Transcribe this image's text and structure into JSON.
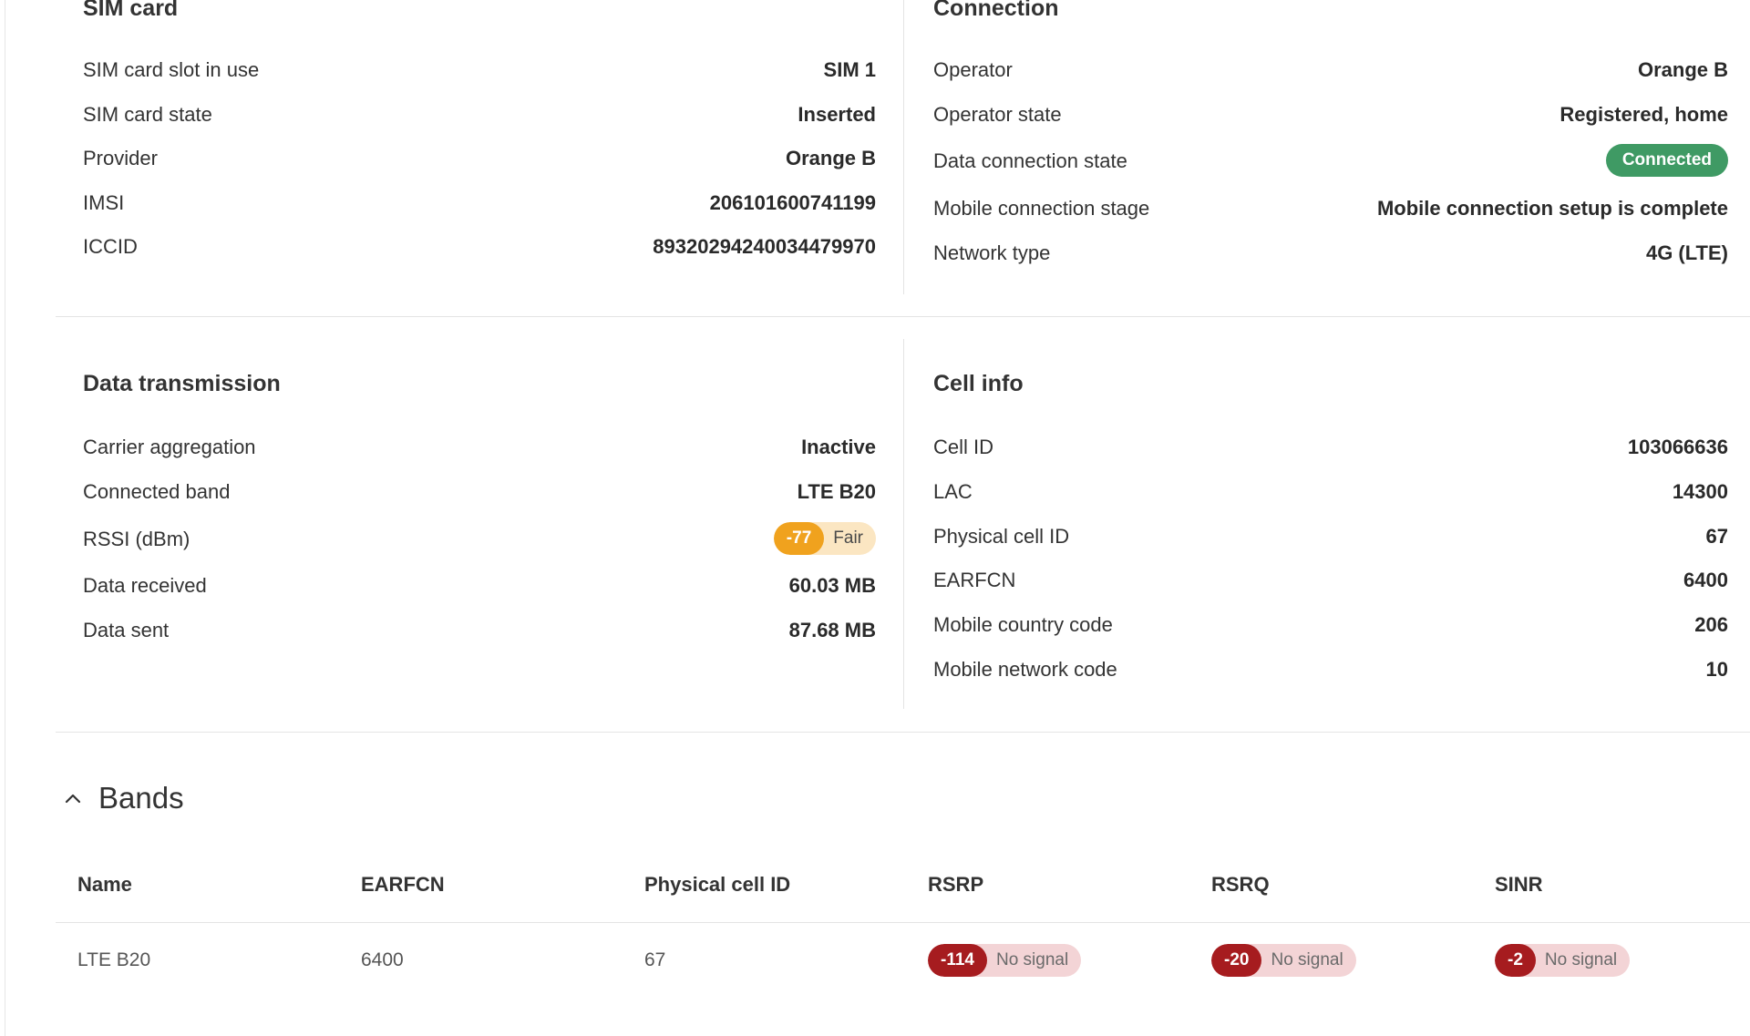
{
  "sim_card": {
    "title": "SIM card",
    "rows": [
      {
        "label": "SIM card slot in use",
        "value": "SIM 1"
      },
      {
        "label": "SIM card state",
        "value": "Inserted"
      },
      {
        "label": "Provider",
        "value": "Orange B"
      },
      {
        "label": "IMSI",
        "value": "206101600741199"
      },
      {
        "label": "ICCID",
        "value": "89320294240034479970"
      }
    ]
  },
  "connection": {
    "title": "Connection",
    "rows": [
      {
        "label": "Operator",
        "value": "Orange B"
      },
      {
        "label": "Operator state",
        "value": "Registered, home"
      },
      {
        "label": "Data connection state",
        "value": "Connected",
        "badge_color": "#3f9a64"
      },
      {
        "label": "Mobile connection stage",
        "value": "Mobile connection setup is complete"
      },
      {
        "label": "Network type",
        "value": "4G (LTE)"
      }
    ]
  },
  "data_transmission": {
    "title": "Data transmission",
    "rows": [
      {
        "label": "Carrier aggregation",
        "value": "Inactive"
      },
      {
        "label": "Connected band",
        "value": "LTE B20"
      },
      {
        "label": "RSSI (dBm)",
        "value": "-77",
        "quality": "Fair",
        "color": "#f0a21e"
      },
      {
        "label": "Data received",
        "value": "60.03 MB"
      },
      {
        "label": "Data sent",
        "value": "87.68 MB"
      }
    ]
  },
  "cell_info": {
    "title": "Cell info",
    "rows": [
      {
        "label": "Cell ID",
        "value": "103066636"
      },
      {
        "label": "LAC",
        "value": "14300"
      },
      {
        "label": "Physical cell ID",
        "value": "67"
      },
      {
        "label": "EARFCN",
        "value": "6400"
      },
      {
        "label": "Mobile country code",
        "value": "206"
      },
      {
        "label": "Mobile network code",
        "value": "10"
      }
    ]
  },
  "bands": {
    "title": "Bands",
    "toggle_icon": "chevron-up-icon",
    "columns": [
      "Name",
      "EARFCN",
      "Physical cell ID",
      "RSRP",
      "RSRQ",
      "SINR"
    ],
    "rows": [
      {
        "name": "LTE B20",
        "earfcn": "6400",
        "pci": "67",
        "rsrp": {
          "value": "-114",
          "quality": "No signal"
        },
        "rsrq": {
          "value": "-20",
          "quality": "No signal"
        },
        "sinr": {
          "value": "-2",
          "quality": "No signal"
        }
      }
    ],
    "bad_color": "#a61c1f"
  }
}
